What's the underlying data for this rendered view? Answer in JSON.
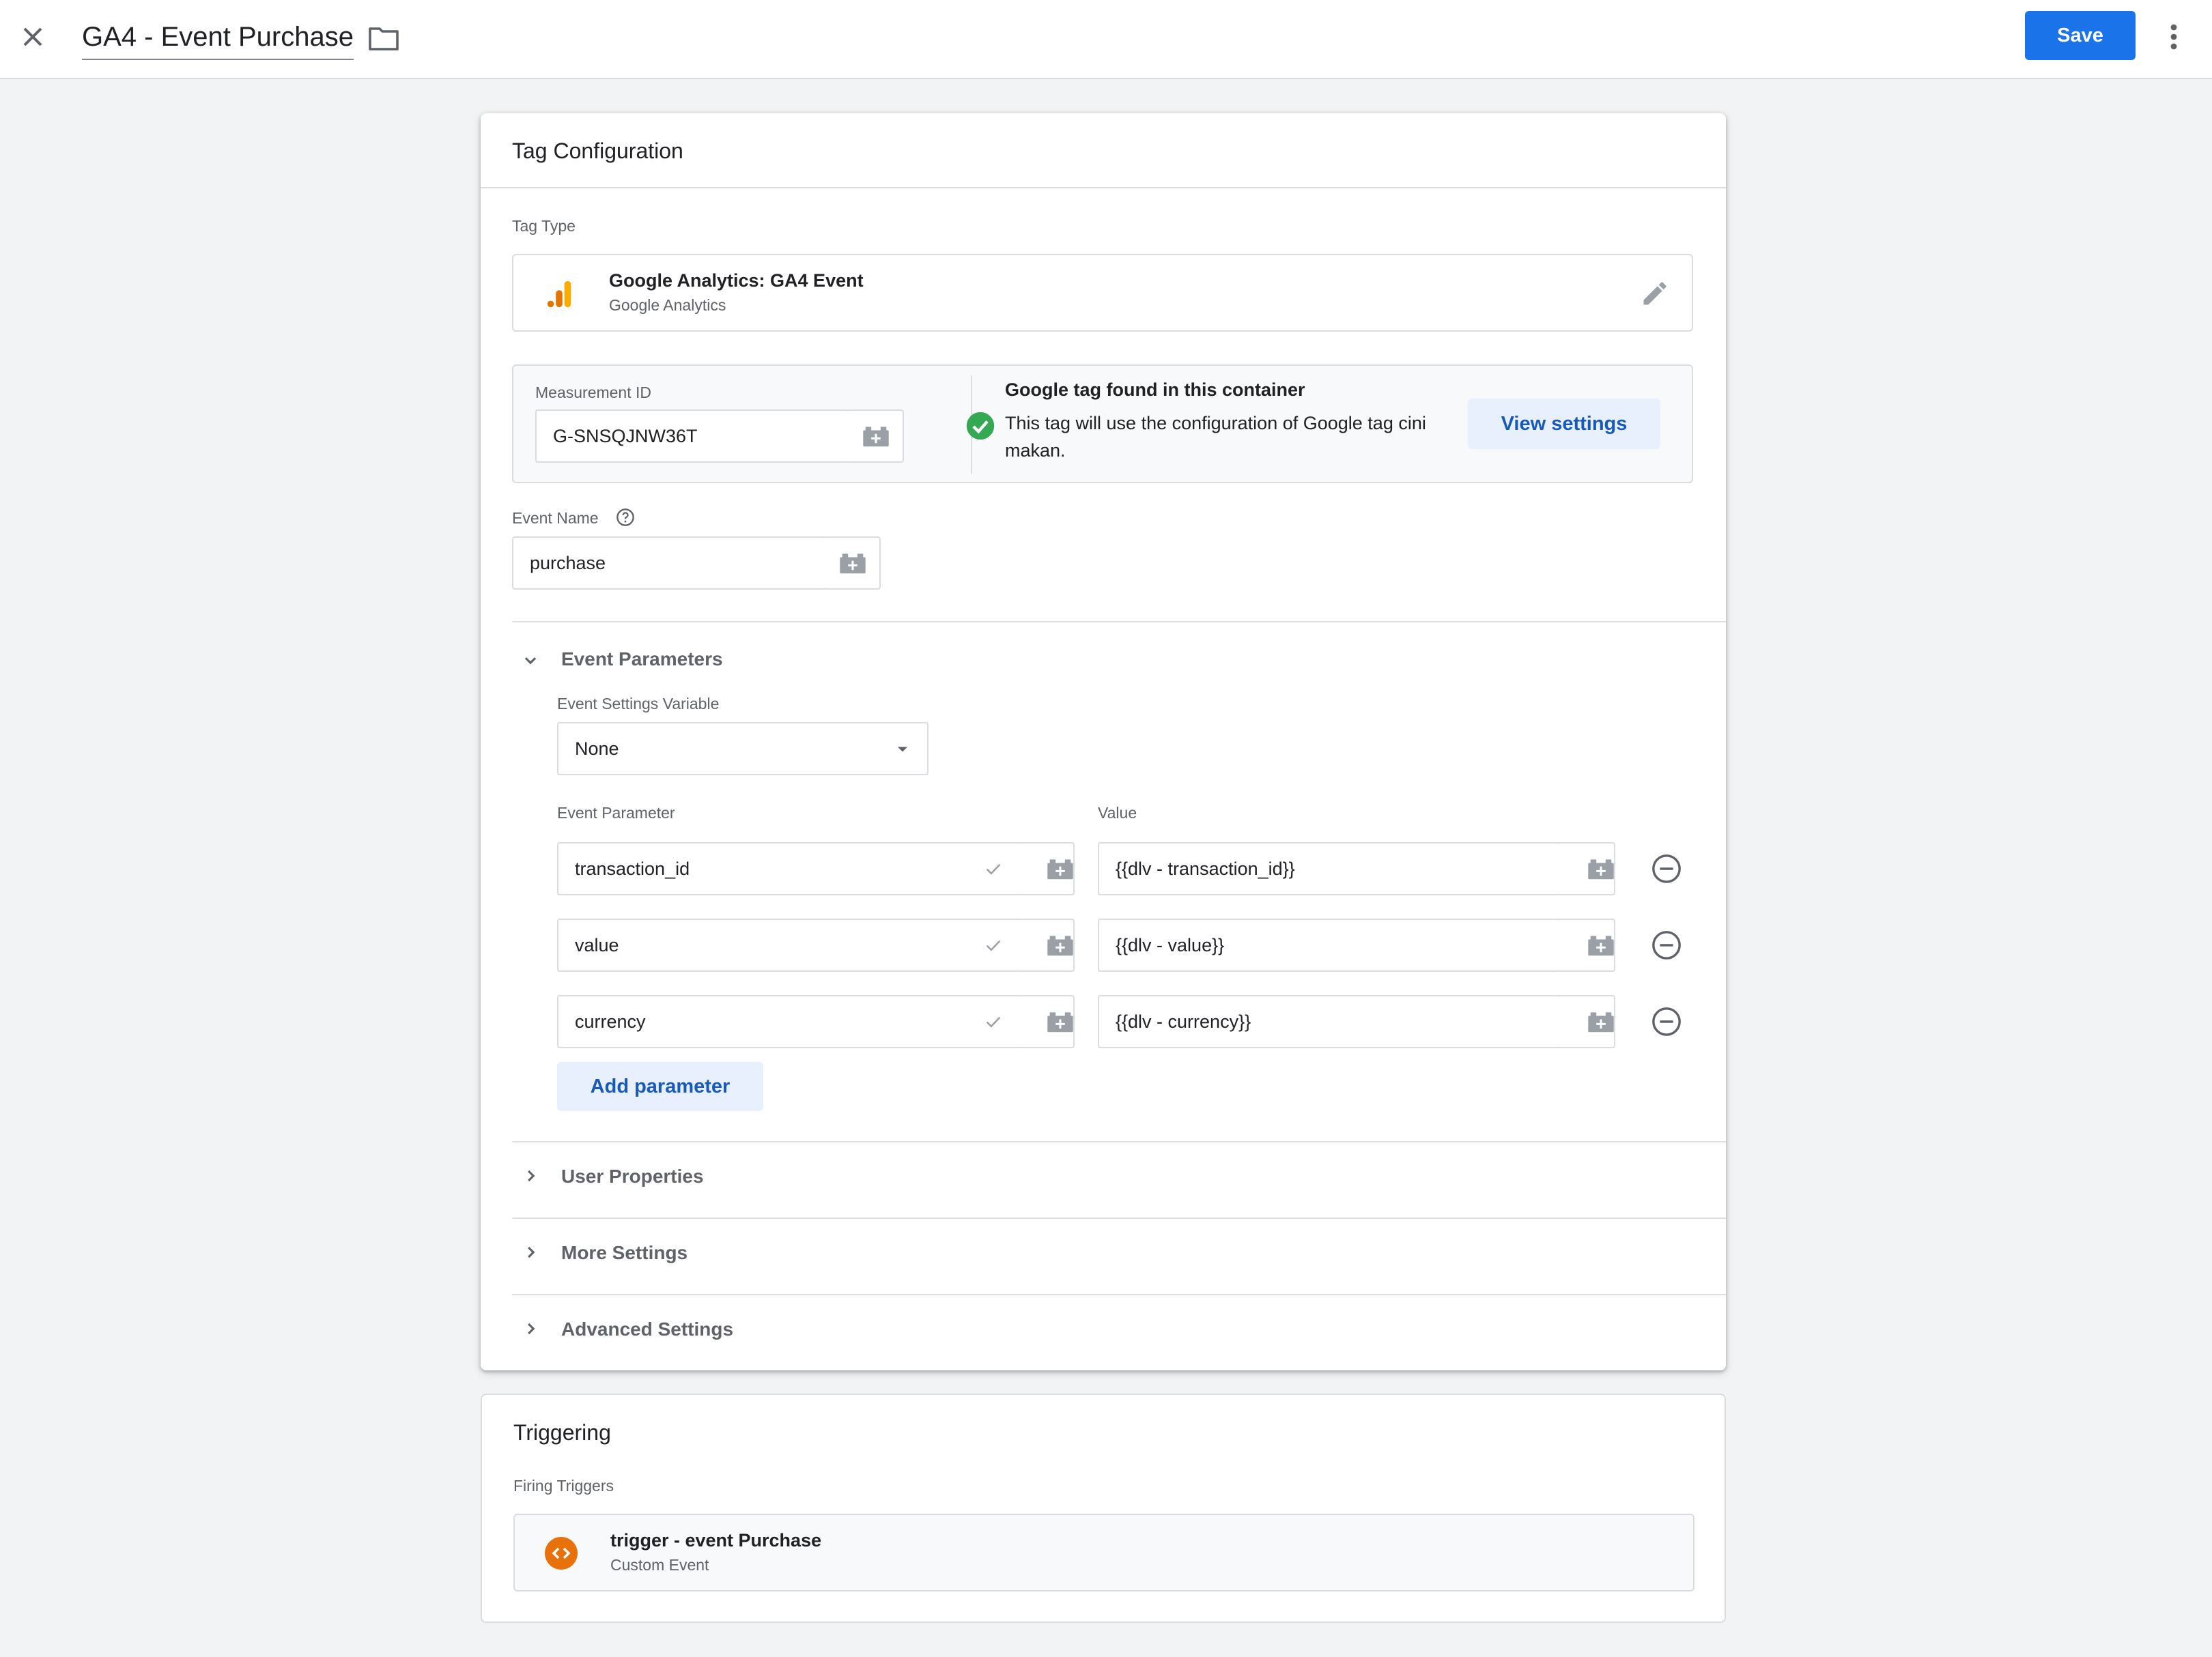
{
  "header": {
    "tag_name": "GA4 - Event Purchase",
    "save_label": "Save"
  },
  "tag_configuration": {
    "title": "Tag Configuration",
    "tag_type_label": "Tag Type",
    "tag_type": {
      "name": "Google Analytics: GA4 Event",
      "provider": "Google Analytics"
    },
    "measurement_id": {
      "label": "Measurement ID",
      "value": "G-SNSQJNW36T"
    },
    "google_tag_notice": {
      "title": "Google tag found in this container",
      "text": "This tag will use the configuration of Google tag cini makan.",
      "button": "View settings"
    },
    "event_name": {
      "label": "Event Name",
      "value": "purchase"
    },
    "event_parameters": {
      "title": "Event Parameters",
      "settings_variable_label": "Event Settings Variable",
      "settings_variable_value": "None",
      "param_col_label": "Event Parameter",
      "value_col_label": "Value",
      "rows": [
        {
          "param": "transaction_id",
          "value": "{{dlv - transaction_id}}"
        },
        {
          "param": "value",
          "value": "{{dlv - value}}"
        },
        {
          "param": "currency",
          "value": "{{dlv - currency}}"
        }
      ],
      "add_button": "Add parameter"
    },
    "sections": [
      {
        "title": "User Properties"
      },
      {
        "title": "More Settings"
      },
      {
        "title": "Advanced Settings"
      }
    ]
  },
  "triggering": {
    "title": "Triggering",
    "firing_label": "Firing Triggers",
    "trigger": {
      "name": "trigger - event Purchase",
      "type": "Custom Event"
    }
  },
  "colors": {
    "primary": "#1a73e8",
    "ga_orange": "#f9ab00",
    "ga_dark_orange": "#e37400",
    "success_green": "#34a853",
    "trigger_orange": "#e8710a"
  },
  "icons": {
    "close": "close-icon",
    "folder": "folder-icon",
    "more": "more-vert-icon",
    "edit": "pencil-icon",
    "variable": "variable-brick-icon",
    "help": "help-icon",
    "check": "check-circle-icon",
    "remove": "remove-circle-icon",
    "chevron_down": "chevron-down-icon",
    "chevron_right": "chevron-right-icon",
    "trigger": "custom-event-icon"
  }
}
